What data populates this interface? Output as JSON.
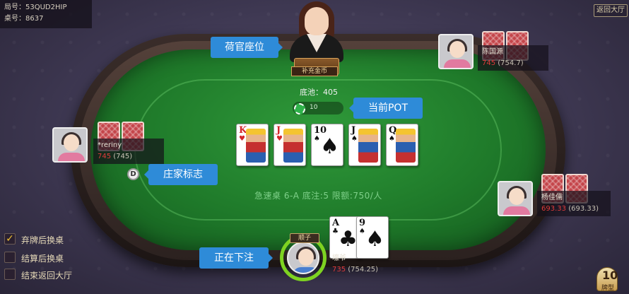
{
  "info": {
    "game_no": "局号：53QUD2HIP",
    "table_no": "桌号：8637"
  },
  "back_button": "返回大厅",
  "dealer": {
    "rack_label": "补充金币"
  },
  "callouts": {
    "dealer_seat": "荷官座位",
    "current_pot": "当前POT",
    "dealer_marker": "庄家标志",
    "betting": "正在下注"
  },
  "pot": {
    "label": "底池：405",
    "bet_value": "10"
  },
  "board": [
    {
      "rank": "K",
      "suit": "♥",
      "color": "red"
    },
    {
      "rank": "J",
      "suit": "♥",
      "color": "red"
    },
    {
      "rank": "10",
      "suit": "♠",
      "color": "black"
    },
    {
      "rank": "J",
      "suit": "♠",
      "color": "black"
    },
    {
      "rank": "Q",
      "suit": "♠",
      "color": "black"
    }
  ],
  "players": {
    "top_right": {
      "name": "陈国源",
      "chips": "745",
      "total": "(754.7)"
    },
    "left": {
      "name": "*reriny",
      "chips": "745",
      "total": "(745)"
    },
    "right": {
      "name": "杨佳儒",
      "chips": "693.33",
      "total": "(693.33)"
    },
    "me": {
      "name": "壕爷",
      "chips": "735",
      "total": "(754.25)",
      "hand_badge": "顺子",
      "cards": [
        {
          "rank": "A",
          "suit": "♣",
          "color": "black"
        },
        {
          "rank": "9",
          "suit": "♠",
          "color": "black"
        }
      ]
    }
  },
  "dealer_button": "D",
  "table_info": "急速桌 6-A  底注:5  限额:750/人",
  "options": [
    {
      "label": "弃牌后换桌",
      "checked": true
    },
    {
      "label": "结算后换桌",
      "checked": false
    },
    {
      "label": "结束返回大厅",
      "checked": false
    }
  ],
  "hand_types_button": {
    "icon": "10",
    "label": "牌型"
  },
  "colors": {
    "felt": "#1f7a2a",
    "callout": "#2e8bd8",
    "active_ring": "#7ed321",
    "chips_red": "#e03b3b"
  }
}
